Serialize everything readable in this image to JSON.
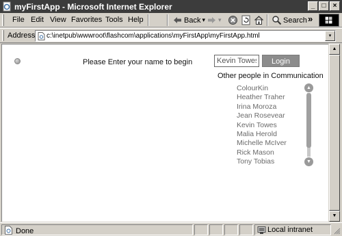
{
  "window": {
    "title": "myFirstApp - Microsoft Internet Explorer",
    "minimize_glyph": "_",
    "maximize_glyph": "□",
    "close_glyph": "×"
  },
  "menu": {
    "items": [
      "File",
      "Edit",
      "View",
      "Favorites",
      "Tools",
      "Help"
    ]
  },
  "toolbar": {
    "back_label": "Back",
    "search_label": "Search",
    "more_glyph": "»",
    "dropdown_glyph": "▾"
  },
  "address_bar": {
    "label": "Address",
    "value": "c:\\inetpub\\wwwroot\\flashcom\\applications\\myFirstApp\\myFirstApp.html"
  },
  "app": {
    "prompt": "Please Enter your name to begin",
    "name_value": "Kevin Towes",
    "login_label": "Login",
    "people_title": "Other people in Communication",
    "people": [
      "ColourKin",
      "Heather Traher",
      "Irina Moroza",
      "Jean Rosevear",
      "Kevin Towes",
      "Malia Herold",
      "Michelle McIver",
      "Rick Mason",
      "Tony Tobias"
    ]
  },
  "statusbar": {
    "status": "Done",
    "zone": "Local intranet"
  },
  "colors": {
    "titlebar_bg": "#3c3c3c",
    "chrome_bg": "#d4d0c8",
    "login_button_bg": "#8c8c8c",
    "list_text": "#6a6a6a"
  },
  "icons": {
    "app": "ie-page-icon",
    "back": "back-arrow-icon",
    "forward": "forward-arrow-icon",
    "stop": "stop-icon",
    "refresh": "refresh-icon",
    "home": "home-icon",
    "search": "search-icon",
    "brand": "windows-logo-icon"
  }
}
